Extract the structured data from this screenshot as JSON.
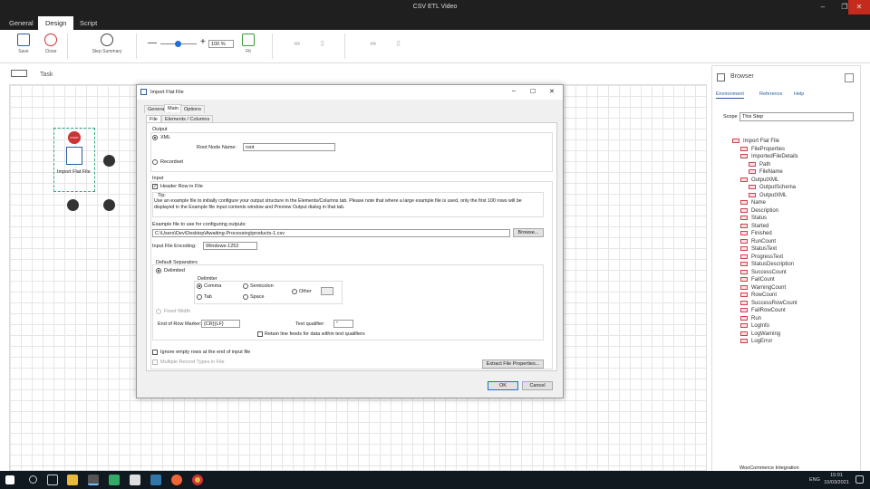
{
  "window": {
    "title": "CSV ETL Video",
    "min": "–",
    "max": "❐",
    "close": "✕"
  },
  "ribbon_tabs": [
    {
      "label": "General"
    },
    {
      "label": "Design"
    },
    {
      "label": "Script"
    }
  ],
  "ribbon": {
    "save": "Save",
    "close": "Close",
    "step_summary": "Step Summary",
    "zoom": "100 %",
    "fit": "Fit"
  },
  "task_label": "Task",
  "canvas": {
    "node_label": "Import Flat File",
    "start_badge": "START"
  },
  "dialog": {
    "title": "Import Flat File",
    "tabs": [
      "General",
      "Main",
      "Options"
    ],
    "subtabs": [
      "File",
      "Elements / Columns"
    ],
    "output_label": "Output",
    "xml": "XML",
    "root_node_label": "Root Node Name:",
    "root_node_value": "root",
    "recordset": "Recordset",
    "input_label": "Input",
    "header_row": "Header Row in File",
    "tip_label": "Tip:",
    "tip_text": "Use an example file to initially configure your output structure in the Elements/Columns tab. Please note that where a large example file is used, only the first 100 rows will be displayed in the Example file input contents window and Preview Output dialog in that tab.",
    "example_label": "Example file to use for configuring outputs:",
    "example_value": "C:\\Users\\Dev\\Desktop\\Awaiting-Processing\\products-1.csv",
    "browse": "Browse...",
    "encoding_label": "Input File Encoding:",
    "encoding_value": "Windows-1252",
    "default_sep": "Default Separators",
    "delimited": "Delimited",
    "delimiter": "Delimiter",
    "comma": "Comma",
    "semicolon": "Semicolon",
    "other": "Other",
    "tab": "Tab",
    "space": "Space",
    "fixed_width": "Fixed Width",
    "eor_label": "End of Row Marker:",
    "eor_value": "{CR}{LF}",
    "text_qual_label": "Text qualifier:",
    "text_qual_value": "\"",
    "retain_lf": "Retain line feeds for data within text qualifiers",
    "ignore_empty": "Ignore empty rows at the end of input file",
    "multiple_record": "Multiple Record Types in File",
    "extract": "Extract File Properties...",
    "ok": "OK",
    "cancel": "Cancel"
  },
  "browser": {
    "title": "Browser",
    "tabs": [
      "Environment",
      "Reference",
      "Help"
    ],
    "scope_label": "Scope",
    "scope_value": "This Step",
    "tree": [
      {
        "label": "Import Flat File",
        "indent": 0
      },
      {
        "label": "FileProperties",
        "indent": 1
      },
      {
        "label": "ImportedFileDetails",
        "indent": 1
      },
      {
        "label": "Path",
        "indent": 2
      },
      {
        "label": "FileName",
        "indent": 2
      },
      {
        "label": "OutputXML",
        "indent": 1
      },
      {
        "label": "OutputSchema",
        "indent": 2
      },
      {
        "label": "OutputXML",
        "indent": 2
      },
      {
        "label": "Name",
        "indent": 1
      },
      {
        "label": "Description",
        "indent": 1
      },
      {
        "label": "Status",
        "indent": 1
      },
      {
        "label": "Started",
        "indent": 1
      },
      {
        "label": "Finished",
        "indent": 1
      },
      {
        "label": "RunCount",
        "indent": 1
      },
      {
        "label": "StatusText",
        "indent": 1
      },
      {
        "label": "ProgressText",
        "indent": 1
      },
      {
        "label": "StatusDescription",
        "indent": 1
      },
      {
        "label": "SuccessCount",
        "indent": 1
      },
      {
        "label": "FailCount",
        "indent": 1
      },
      {
        "label": "WarningCount",
        "indent": 1
      },
      {
        "label": "RowCount",
        "indent": 1
      },
      {
        "label": "SuccessRowCount",
        "indent": 1
      },
      {
        "label": "FailRowCount",
        "indent": 1
      },
      {
        "label": "Run",
        "indent": 1
      },
      {
        "label": "LogInfo",
        "indent": 1
      },
      {
        "label": "LogWarning",
        "indent": 1
      },
      {
        "label": "LogError",
        "indent": 1
      }
    ],
    "footer": "WooCommerce Integration"
  },
  "taskbar": {
    "time": "15:01",
    "date": "10/03/2021",
    "lang": "ENG"
  }
}
